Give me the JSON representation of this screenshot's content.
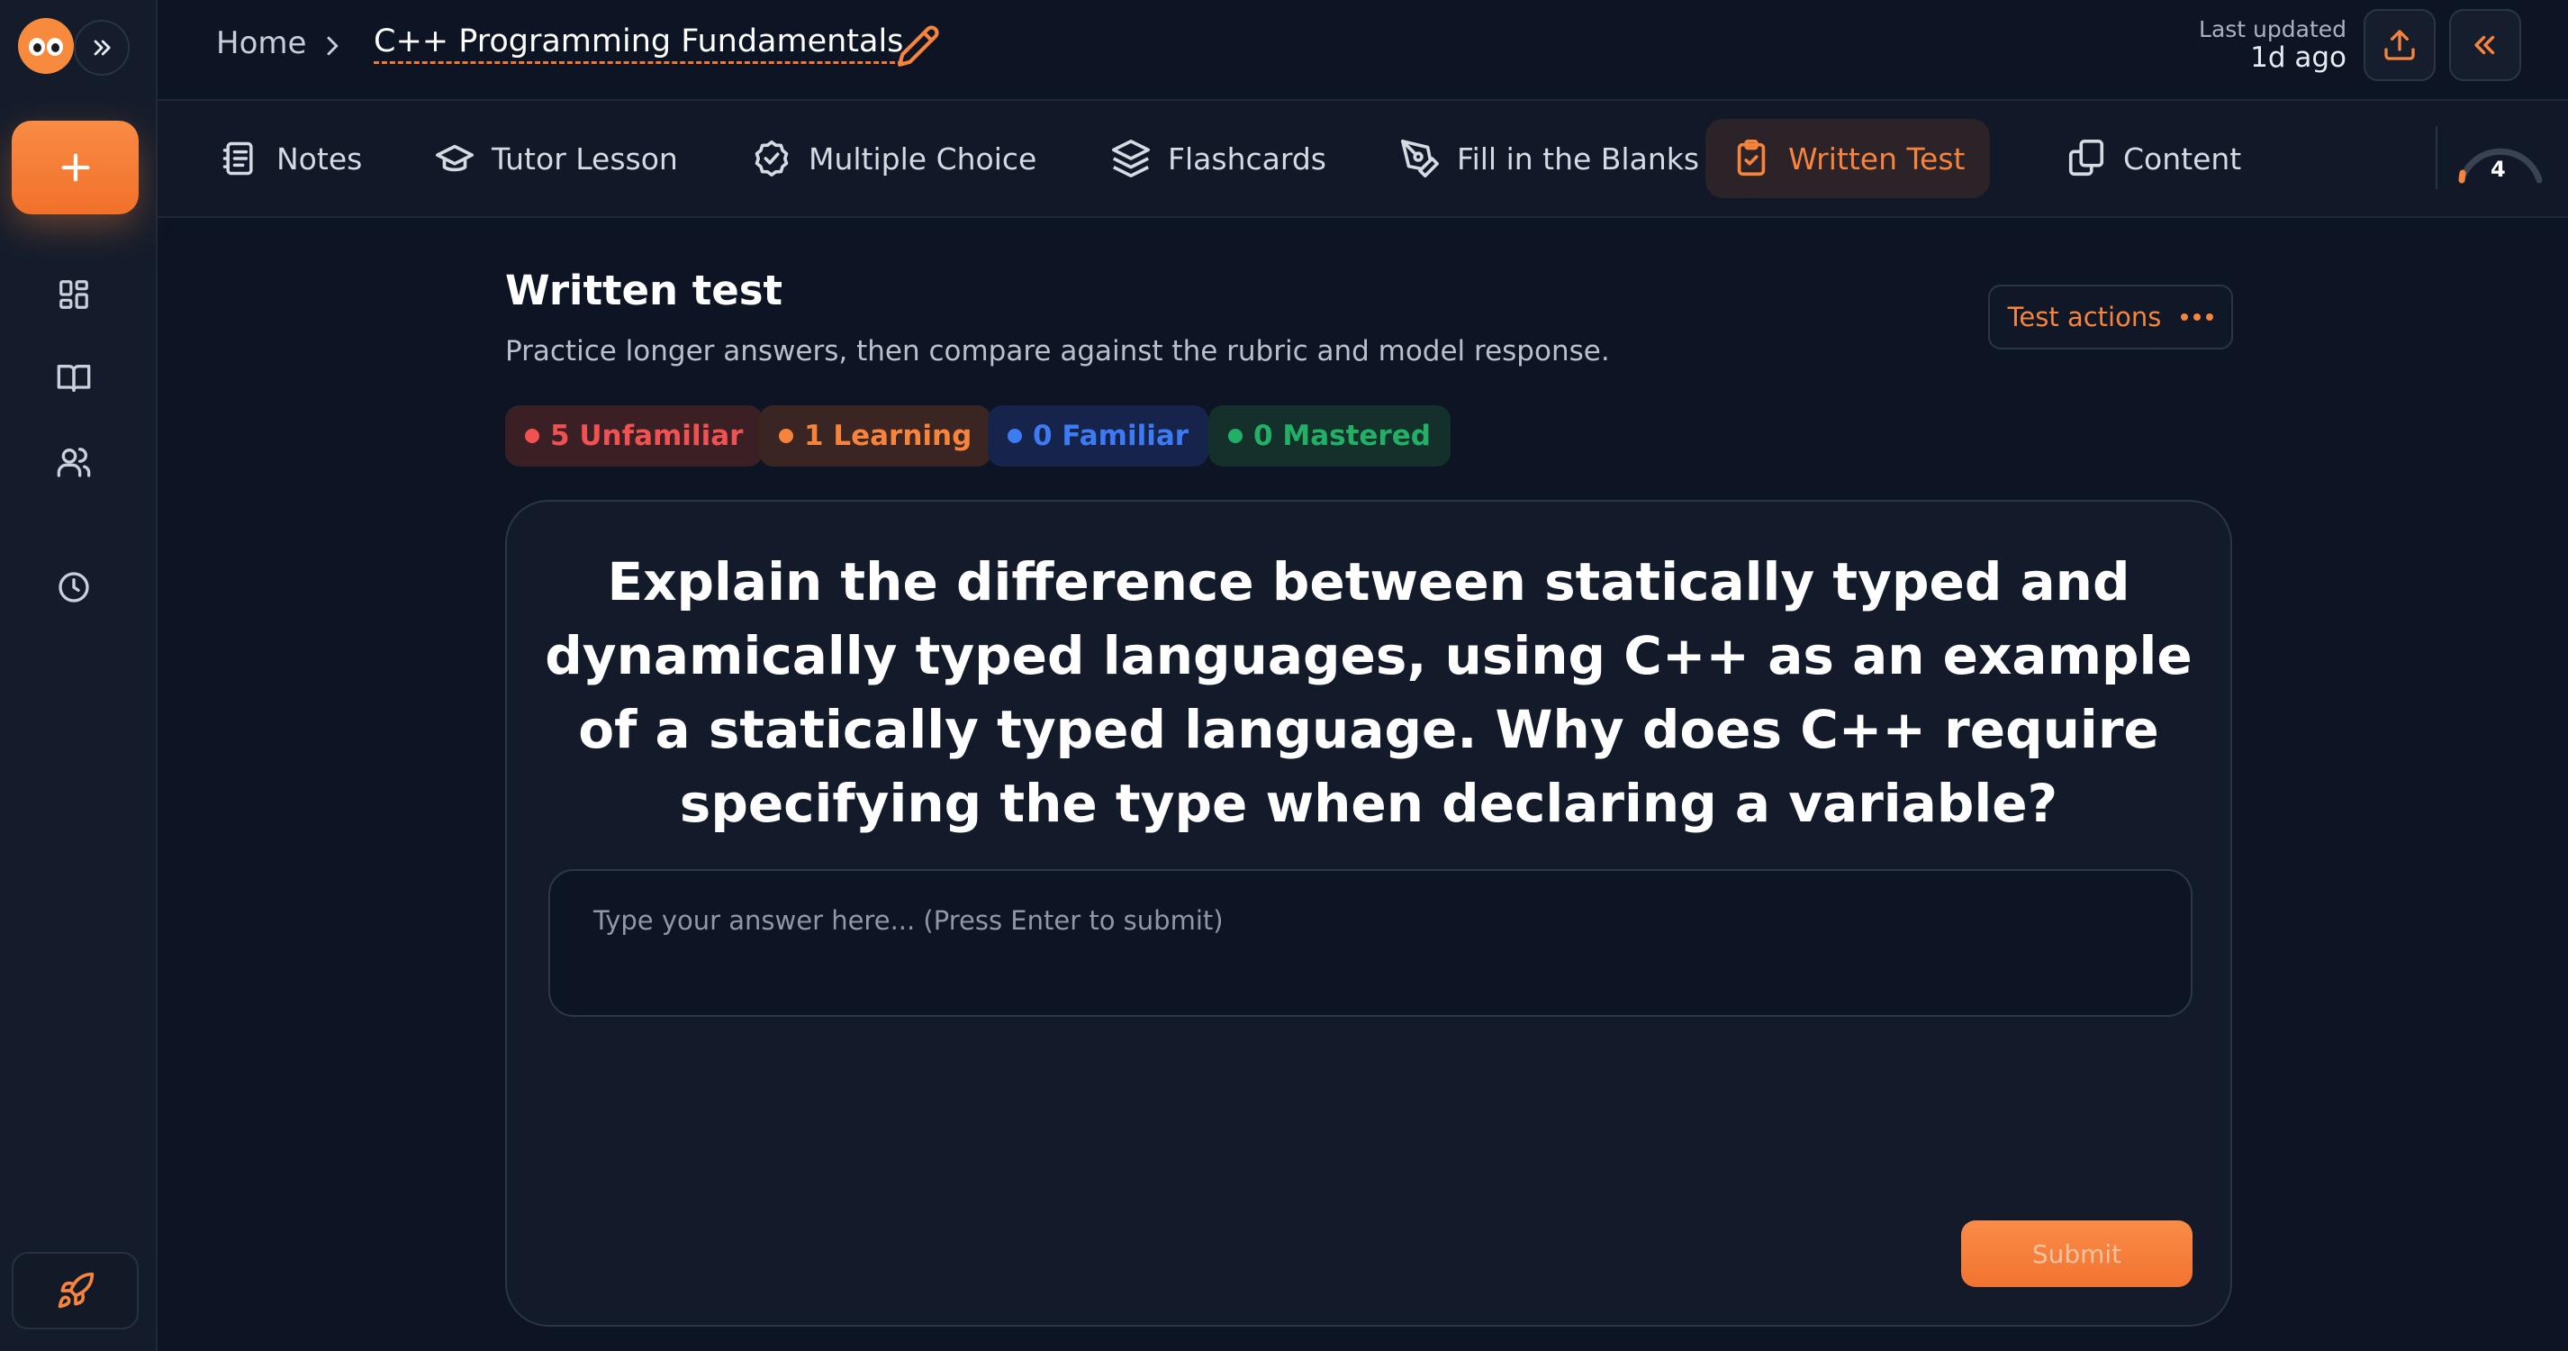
{
  "breadcrumb": {
    "home": "Home",
    "title": "C++ Programming Fundamentals"
  },
  "header": {
    "last_updated_label": "Last updated",
    "last_updated_value": "1d ago"
  },
  "tabs": [
    {
      "label": "Notes",
      "icon": "notes-icon"
    },
    {
      "label": "Tutor Lesson",
      "icon": "graduation-cap-icon"
    },
    {
      "label": "Multiple Choice",
      "icon": "check-circle-icon"
    },
    {
      "label": "Flashcards",
      "icon": "layers-icon"
    },
    {
      "label": "Fill in the Blanks",
      "icon": "pen-tool-icon"
    },
    {
      "label": "Written Test",
      "icon": "clipboard-check-icon",
      "active": true
    },
    {
      "label": "Content",
      "icon": "copy-icon"
    }
  ],
  "gauge": {
    "value": "4"
  },
  "main": {
    "title": "Written test",
    "subtitle": "Practice longer answers, then compare against the rubric and model response.",
    "test_actions_label": "Test actions",
    "pills": {
      "unfamiliar": "5 Unfamiliar",
      "learning": "1 Learning",
      "familiar": "0 Familiar",
      "mastered": "0 Mastered"
    },
    "question": "Explain the difference between statically typed and dynamically typed languages, using C++ as an example of a statically typed language. Why does C++ require specifying the type when declaring a variable?",
    "answer_placeholder": "Type your answer here... (Press Enter to submit)",
    "answer_value": "",
    "submit_label": "Submit"
  },
  "colors": {
    "accent": "#f7843c",
    "background": "#0d1424",
    "unfamiliar": "#f05252",
    "familiar": "#3d7bf5",
    "mastered": "#22b067"
  }
}
